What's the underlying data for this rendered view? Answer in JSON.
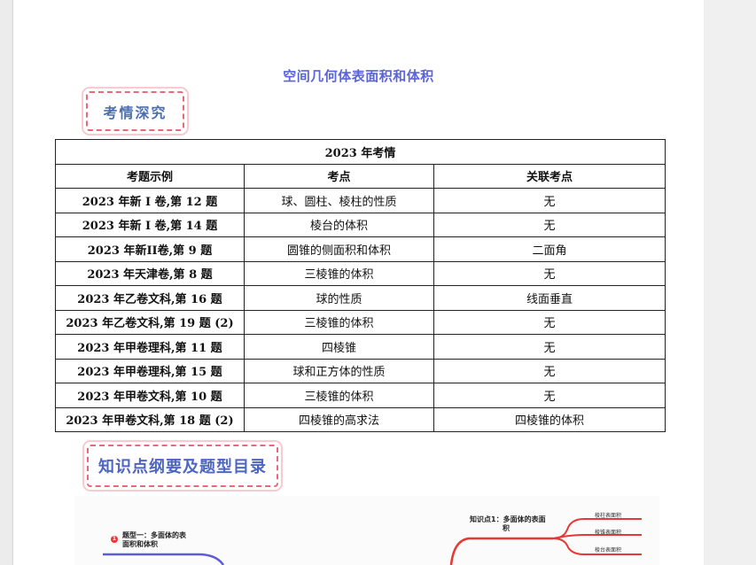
{
  "document": {
    "title": "空间几何体表面积和体积"
  },
  "sections": {
    "kaoqing": "考情深究",
    "zhishi": "知识点纲要及题型目录"
  },
  "table": {
    "caption": "2023 年考情",
    "headers": [
      "考题示例",
      "考点",
      "关联考点"
    ],
    "rows": [
      [
        "2023 年新 I 卷,第 12 题",
        "球、圆柱、棱柱的性质",
        "无"
      ],
      [
        "2023 年新 I 卷,第 14 题",
        "棱台的体积",
        "无"
      ],
      [
        "2023 年新II卷,第 9 题",
        "圆锥的侧面积和体积",
        "二面角"
      ],
      [
        "2023 年天津卷,第 8 题",
        "三棱锥的体积",
        "无"
      ],
      [
        "2023 年乙卷文科,第 16 题",
        "球的性质",
        "线面垂直"
      ],
      [
        "2023 年乙卷文科,第 19 题 (2)",
        "三棱锥的体积",
        "无"
      ],
      [
        "2023 年甲卷理科,第 11 题",
        "四棱锥",
        "无"
      ],
      [
        "2023 年甲卷理科,第 15 题",
        "球和正方体的性质",
        "无"
      ],
      [
        "2023 年甲卷文科,第 10 题",
        "三棱锥的体积",
        "无"
      ],
      [
        "2023 年甲卷文科,第 18 题 (2)",
        "四棱锥的高求法",
        "四棱锥的体积"
      ]
    ]
  },
  "mindmap": {
    "badge": "1",
    "left_topic_line1": "题型一：多面体的表",
    "left_topic_line2": "面积和体积",
    "right_topic_line1": "知识点1：多面体的表面",
    "right_topic_line2": "积",
    "branches": [
      "棱柱表面积",
      "棱锥表面积",
      "棱台表面积"
    ],
    "colors": {
      "left_branch": "#5b5bd6",
      "right_branch": "#e53935"
    }
  }
}
